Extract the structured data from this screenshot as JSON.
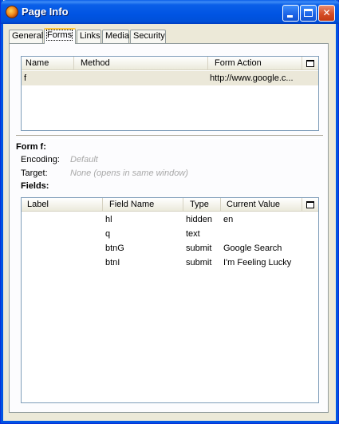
{
  "window": {
    "title": "Page Info",
    "controls": {
      "minimize": "minimize",
      "maximize": "maximize",
      "close": "✕"
    }
  },
  "tabs": [
    {
      "label": "General",
      "active": false
    },
    {
      "label": "Forms",
      "active": true
    },
    {
      "label": "Links",
      "active": false
    },
    {
      "label": "Media",
      "active": false
    },
    {
      "label": "Security",
      "active": false
    }
  ],
  "forms_list": {
    "columns": [
      "Name",
      "Method",
      "Form Action"
    ],
    "rows": [
      {
        "name": "f",
        "method": "",
        "action": "http://www.google.c...",
        "selected": true
      }
    ]
  },
  "form_details": {
    "title": "Form f:",
    "encoding_label": "Encoding:",
    "encoding_value": "Default",
    "target_label": "Target:",
    "target_value": "None (opens in same window)",
    "fields_label": "Fields:"
  },
  "fields_list": {
    "columns": [
      "Label",
      "Field Name",
      "Type",
      "Current Value"
    ],
    "rows": [
      {
        "label": "",
        "field_name": "hl",
        "type": "hidden",
        "value": "en"
      },
      {
        "label": "",
        "field_name": "q",
        "type": "text",
        "value": ""
      },
      {
        "label": "",
        "field_name": "btnG",
        "type": "submit",
        "value": "Google Search"
      },
      {
        "label": "",
        "field_name": "btnI",
        "type": "submit",
        "value": "I'm Feeling Lucky"
      }
    ]
  },
  "icons": {
    "app": "firefox-icon",
    "column_picker": "column-picker-icon"
  },
  "colors": {
    "titlebar": "#0054e3",
    "tab_highlight": "#ffc83c",
    "selected_row": "#ebe8d9",
    "disabled_text": "#a8a8a8"
  }
}
